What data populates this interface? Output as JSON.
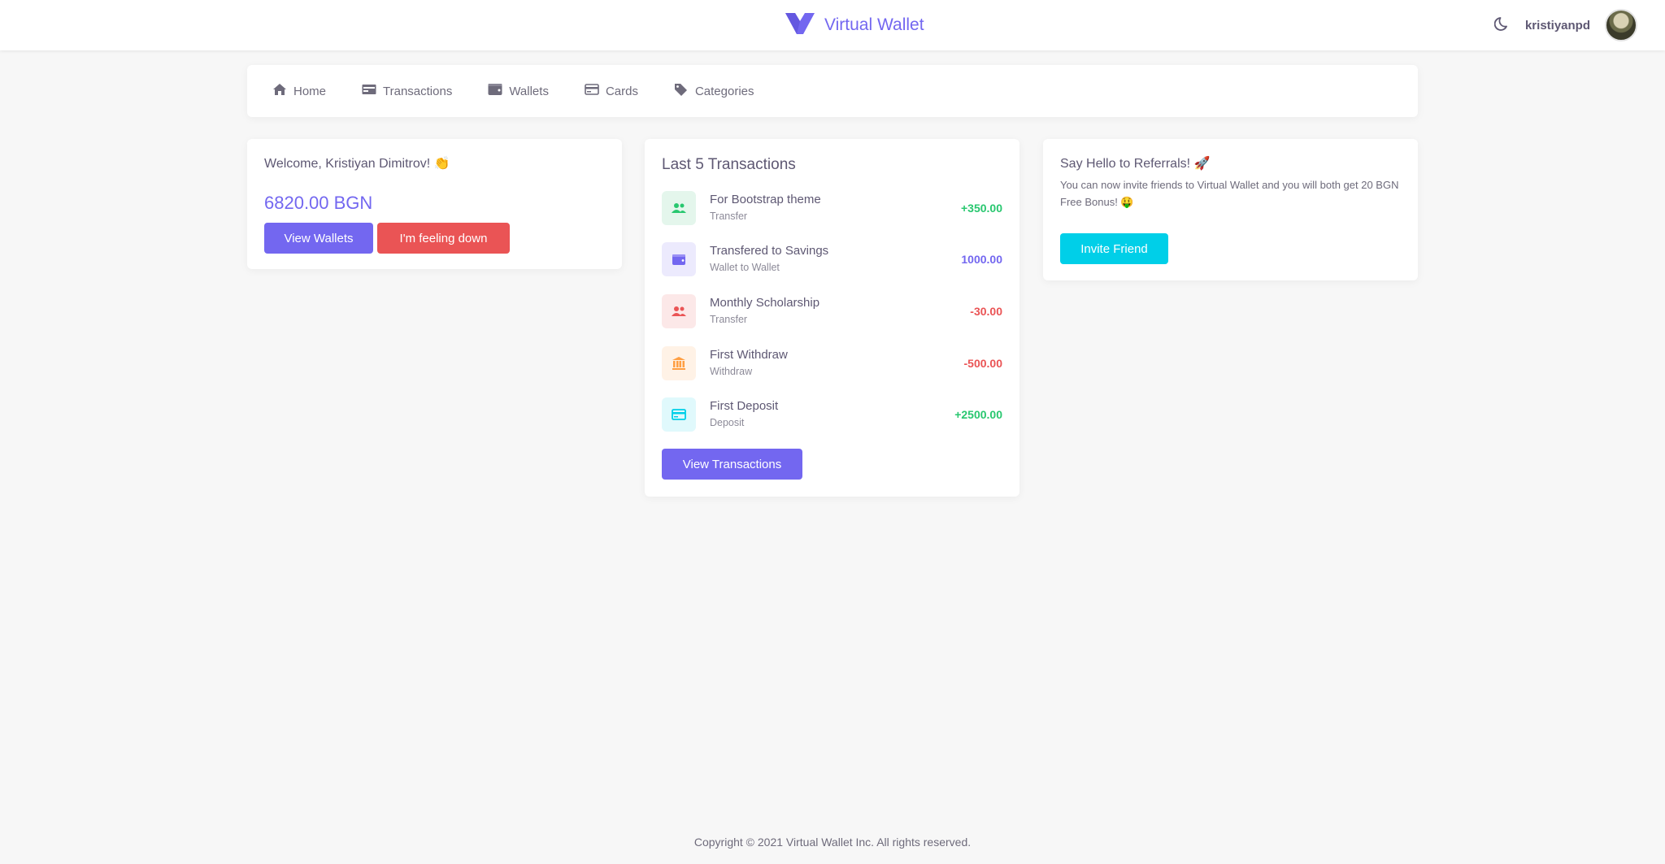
{
  "header": {
    "brand": "Virtual Wallet",
    "username": "kristiyanpd",
    "accent_color": "#7367f0"
  },
  "nav": [
    {
      "label": "Home",
      "icon": "home-icon"
    },
    {
      "label": "Transactions",
      "icon": "money-bill-icon"
    },
    {
      "label": "Wallets",
      "icon": "wallet-icon"
    },
    {
      "label": "Cards",
      "icon": "credit-card-icon"
    },
    {
      "label": "Categories",
      "icon": "tags-icon"
    }
  ],
  "welcome": {
    "greeting": "Welcome, Kristiyan Dimitrov! 👏",
    "balance": "6820.00 BGN",
    "view_wallets_label": "View Wallets",
    "feeling_down_label": "I'm feeling down"
  },
  "transactions": {
    "title": "Last 5 Transactions",
    "items": [
      {
        "name": "For Bootstrap theme",
        "type": "Transfer",
        "amount": "+350.00",
        "icon": "users-icon",
        "color": "#28c76f",
        "bg": "#e4f6ec"
      },
      {
        "name": "Transfered to Savings",
        "type": "Wallet to Wallet",
        "amount": "1000.00",
        "icon": "wallet-icon",
        "color": "#7367f0",
        "bg": "#eceafd"
      },
      {
        "name": "Monthly Scholarship",
        "type": "Transfer",
        "amount": "-30.00",
        "icon": "users-icon",
        "color": "#ea5455",
        "bg": "#fce8e8"
      },
      {
        "name": "First Withdraw",
        "type": "Withdraw",
        "amount": "-500.00",
        "icon": "bank-icon",
        "color": "#ff9f43",
        "bg": "#fff2e6"
      },
      {
        "name": "First Deposit",
        "type": "Deposit",
        "amount": "+2500.00",
        "icon": "credit-card-icon",
        "color": "#00cfe8",
        "bg": "#e0f9fc"
      }
    ],
    "view_label": "View Transactions"
  },
  "referral": {
    "title": "Say Hello to Referrals! 🚀",
    "text": "You can now invite friends to Virtual Wallet and you will both get 20 BGN Free Bonus! 🤑",
    "button_label": "Invite Friend"
  },
  "footer": {
    "copyright": "Copyright © 2021 Virtual Wallet Inc. All rights reserved."
  }
}
